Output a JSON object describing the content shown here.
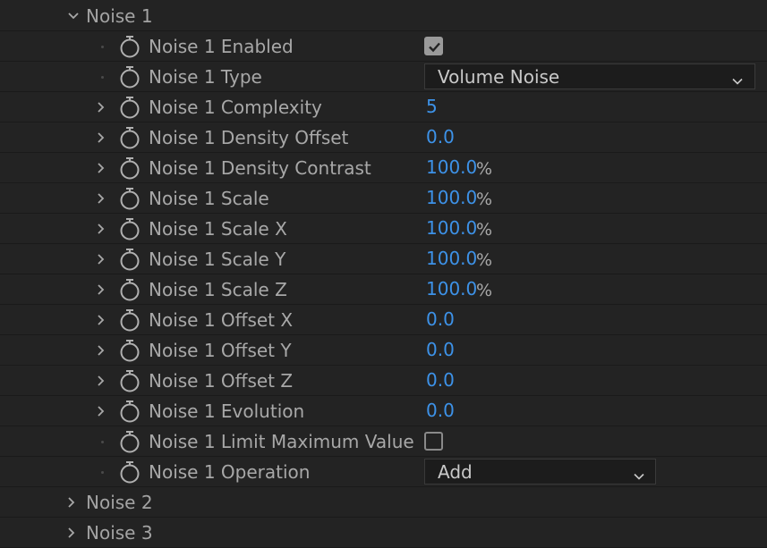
{
  "groups": {
    "noise1": "Noise 1",
    "noise2": "Noise 2",
    "noise3": "Noise 3"
  },
  "properties": {
    "enabled": {
      "label": "Noise 1 Enabled",
      "checked": true
    },
    "type": {
      "label": "Noise 1 Type",
      "value": "Volume Noise"
    },
    "complexity": {
      "label": "Noise 1 Complexity",
      "value": "5"
    },
    "density_offset": {
      "label": "Noise 1 Density Offset",
      "value": "0.0"
    },
    "density_contrast": {
      "label": "Noise 1 Density Contrast",
      "value": "100.0",
      "unit": "%"
    },
    "scale": {
      "label": "Noise 1 Scale",
      "value": "100.0",
      "unit": "%"
    },
    "scale_x": {
      "label": "Noise 1 Scale X",
      "value": "100.0",
      "unit": "%"
    },
    "scale_y": {
      "label": "Noise 1 Scale Y",
      "value": "100.0",
      "unit": "%"
    },
    "scale_z": {
      "label": "Noise 1 Scale Z",
      "value": "100.0",
      "unit": "%"
    },
    "offset_x": {
      "label": "Noise 1 Offset X",
      "value": "0.0"
    },
    "offset_y": {
      "label": "Noise 1 Offset Y",
      "value": "0.0"
    },
    "offset_z": {
      "label": "Noise 1 Offset Z",
      "value": "0.0"
    },
    "evolution": {
      "label": "Noise 1 Evolution",
      "value": "0.0"
    },
    "limit_max": {
      "label": "Noise 1 Limit Maximum Value",
      "checked": false
    },
    "operation": {
      "label": "Noise 1 Operation",
      "value": "Add"
    }
  },
  "icons": {
    "expand": "chevron-right-icon",
    "collapse": "chevron-down-icon",
    "keyframe": "stopwatch-icon",
    "checkmark": "checkmark-icon"
  },
  "colors": {
    "background": "#232323",
    "label": "#a8a8a8",
    "value": "#3d92e8"
  }
}
